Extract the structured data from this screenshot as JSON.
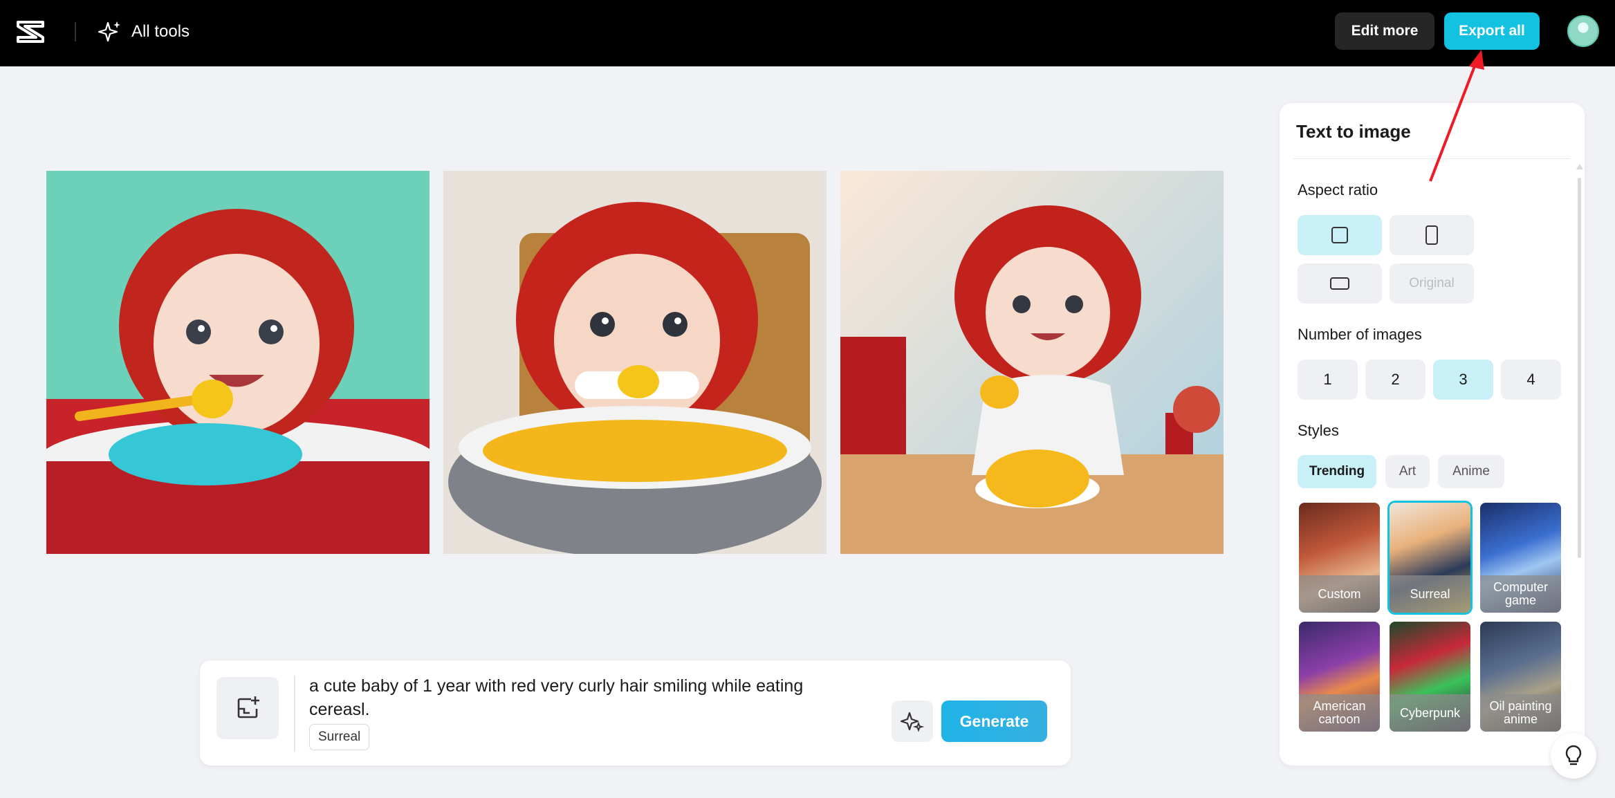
{
  "topbar": {
    "all_tools_label": "All tools",
    "edit_more_label": "Edit more",
    "export_all_label": "Export all",
    "accent": "#12c2e0"
  },
  "images": [
    {
      "alt": "baby-with-spoon-blue-cereal"
    },
    {
      "alt": "baby-at-grey-bowl"
    },
    {
      "alt": "baby-at-table-yellow-cereal"
    }
  ],
  "prompt": {
    "text": "a cute baby of 1 year with red very curly hair smiling while eating cereasl.",
    "style_tag": "Surreal",
    "generate_label": "Generate"
  },
  "panel": {
    "title": "Text to image",
    "aspect_ratio_label": "Aspect ratio",
    "aspect_ratio_options": [
      "square",
      "portrait",
      "landscape",
      "Original"
    ],
    "aspect_ratio_selected": "square",
    "number_label": "Number of images",
    "numbers": [
      "1",
      "2",
      "3",
      "4"
    ],
    "number_selected": "3",
    "styles_label": "Styles",
    "style_tabs": [
      "Trending",
      "Art",
      "Anime"
    ],
    "style_tab_selected": "Trending",
    "styles": [
      {
        "label": "Custom"
      },
      {
        "label": "Surreal",
        "selected": true
      },
      {
        "label": "Computer game"
      },
      {
        "label": "American cartoon"
      },
      {
        "label": "Cyberpunk"
      },
      {
        "label": "Oil painting anime"
      }
    ]
  }
}
